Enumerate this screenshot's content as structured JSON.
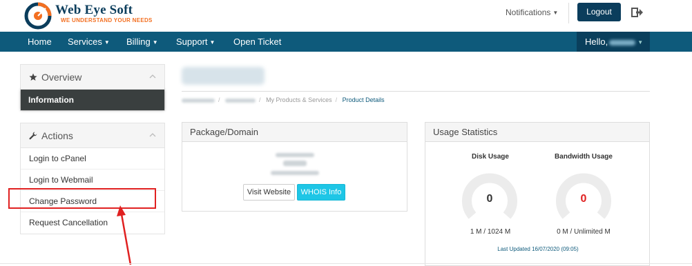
{
  "brand": {
    "name": "Web Eye Soft",
    "tagline": "WE UNDERSTAND YOUR NEEDS",
    "colors": {
      "primary": "#0b3d5c",
      "accent": "#f36f21"
    }
  },
  "header": {
    "notifications_label": "Notifications",
    "logout_label": "Logout",
    "logout_icon": "sign-out-icon"
  },
  "nav": {
    "items": [
      {
        "label": "Home",
        "has_caret": false
      },
      {
        "label": "Services",
        "has_caret": true
      },
      {
        "label": "Billing",
        "has_caret": true
      },
      {
        "label": "Support",
        "has_caret": true
      },
      {
        "label": "Open Ticket",
        "has_caret": false
      }
    ],
    "hello_label": "Hello,",
    "bar_color": "#0e5a7b"
  },
  "sidebar": {
    "overview": {
      "title": "Overview",
      "icon": "star-icon",
      "items": [
        {
          "label": "Information",
          "active": true
        }
      ]
    },
    "actions": {
      "title": "Actions",
      "icon": "wrench-icon",
      "items": [
        {
          "label": "Login to cPanel"
        },
        {
          "label": "Login to Webmail"
        },
        {
          "label": "Change Password"
        },
        {
          "label": "Request Cancellation"
        }
      ]
    }
  },
  "main": {
    "breadcrumb": {
      "items": [
        "My Products & Services",
        "Product Details"
      ]
    },
    "package": {
      "title": "Package/Domain",
      "visit_label": "Visit Website",
      "whois_label": "WHOIS Info"
    },
    "usage": {
      "title": "Usage Statistics",
      "disk": {
        "label": "Disk Usage",
        "value": "0",
        "detail": "1 M / 1024 M",
        "color": "#333333"
      },
      "bandwidth": {
        "label": "Bandwidth Usage",
        "value": "0",
        "detail": "0 M / Unlimited M",
        "color": "#e02020"
      },
      "last_updated": "Last Updated 16/07/2020 (09:05)"
    }
  },
  "annotation": {
    "color": "#e02020"
  }
}
